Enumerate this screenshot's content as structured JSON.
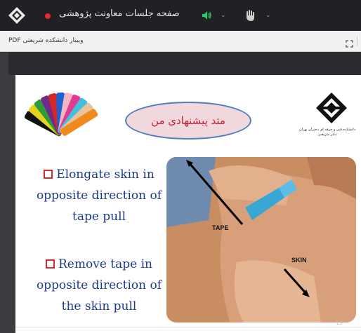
{
  "app": {
    "title": "صفحه جلسات معاونت پژوهشی"
  },
  "file": {
    "name": "PDF وبینار دانشکده شریعتی"
  },
  "slide": {
    "heading": "متد پیشنهادی من",
    "logo_caption_line1": "دانشکده فنی و حرفه ای دختران تهران",
    "logo_caption_line2": "دکتر شریعتی",
    "bullets": [
      {
        "lines": [
          "Elongate skin in",
          "opposite direction of",
          "tape pull"
        ]
      },
      {
        "lines": [
          "Remove tape in",
          "opposite direction of",
          "the skin pull"
        ]
      }
    ],
    "photo_labels": {
      "tape": "TAPE",
      "skin": "SKIN"
    },
    "page_number": "19"
  },
  "icons": {
    "logo": "app-logo-icon",
    "recording": "recording-dot-icon",
    "speaker": "speaker-icon",
    "hand": "raise-hand-icon",
    "chevron": "chevron-down-icon",
    "expand": "expand-icon"
  },
  "colors": {
    "recording": "#e5292f",
    "speaker": "#2ecc71",
    "bullet_text": "#1e3a8a",
    "bullet_box": "#d12b2b",
    "heading_text": "#c41e3a",
    "oval_border": "#4f7dc5",
    "oval_fill": "#f0d8dc"
  }
}
